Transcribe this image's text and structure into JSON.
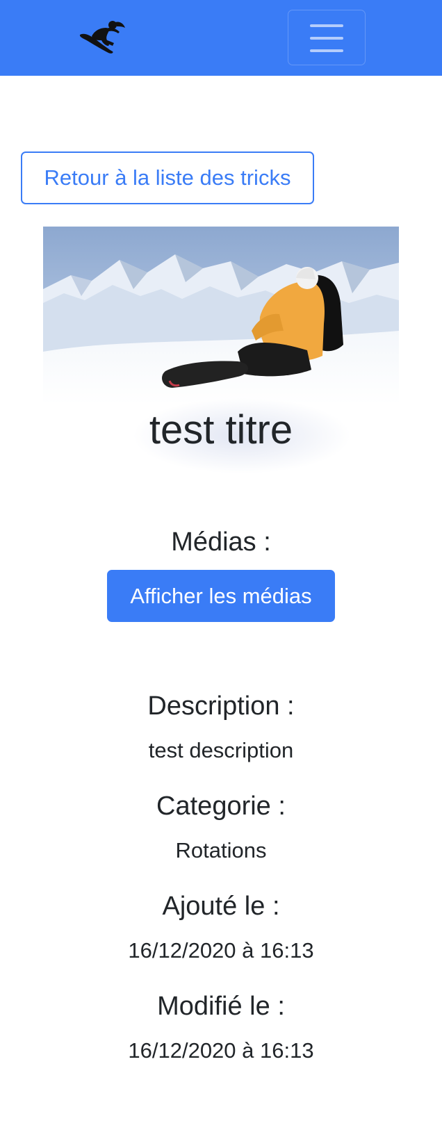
{
  "header": {
    "logo_icon": "snowboarder-icon",
    "menu_icon": "hamburger-icon",
    "background_color": "#3a7cf6"
  },
  "main": {
    "back_button_label": "Retour à la liste des tricks",
    "image_icon": "snowboarder-photo",
    "title": "test titre",
    "media": {
      "heading": "Médias :",
      "button_label": "Afficher les médias"
    },
    "description": {
      "heading": "Description :",
      "value": "test description"
    },
    "category": {
      "heading": "Categorie :",
      "value": "Rotations"
    },
    "created": {
      "heading": "Ajouté le :",
      "value": "16/12/2020 à 16:13"
    },
    "modified": {
      "heading": "Modifié le :",
      "value": "16/12/2020 à 16:13"
    }
  },
  "colors": {
    "primary": "#3a7cf6",
    "text": "#212529"
  }
}
